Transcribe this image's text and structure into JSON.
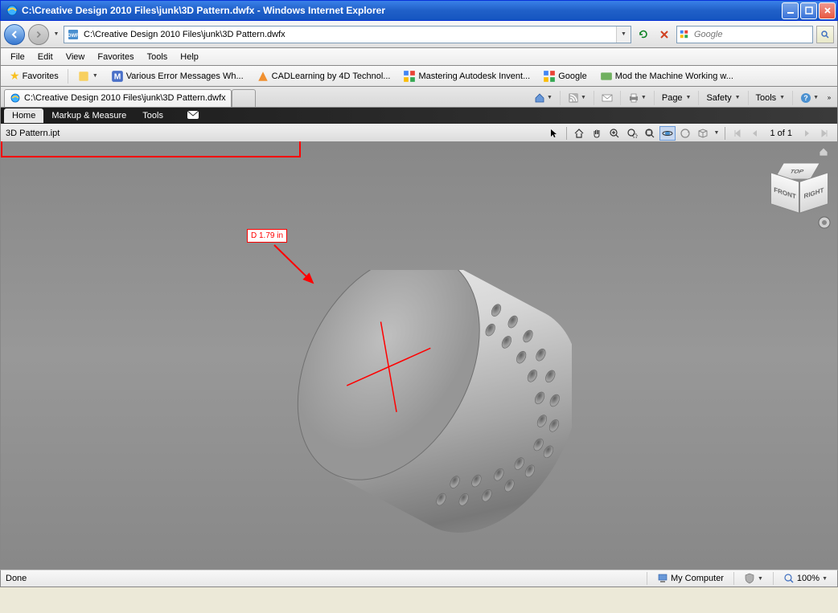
{
  "window": {
    "title": "C:\\Creative Design 2010 Files\\junk\\3D Pattern.dwfx - Windows Internet Explorer"
  },
  "nav": {
    "url": "C:\\Creative Design 2010 Files\\junk\\3D Pattern.dwfx",
    "search_placeholder": "Google"
  },
  "menu": {
    "items": [
      "File",
      "Edit",
      "View",
      "Favorites",
      "Tools",
      "Help"
    ]
  },
  "favorites": {
    "label": "Favorites",
    "items": [
      {
        "label": "Various Error Messages Wh...",
        "icon": "M"
      },
      {
        "label": "CADLearning by 4D Technol...",
        "icon": "A"
      },
      {
        "label": "Mastering Autodesk Invent...",
        "icon": "G"
      },
      {
        "label": "Google",
        "icon": "G"
      },
      {
        "label": "Mod the Machine Working w...",
        "icon": "B"
      }
    ]
  },
  "tab": {
    "label": "C:\\Creative Design 2010 Files\\junk\\3D Pattern.dwfx"
  },
  "command_bar": {
    "page": "Page",
    "safety": "Safety",
    "tools": "Tools"
  },
  "viewer": {
    "menu": [
      "Home",
      "Markup & Measure",
      "Tools"
    ],
    "filename": "3D Pattern.ipt",
    "page_indicator": "1 of 1",
    "cube": {
      "top": "TOP",
      "front": "FRONT",
      "right": "RIGHT"
    }
  },
  "annotation": {
    "label": "D 1.79 in"
  },
  "status": {
    "left": "Done",
    "zone": "My Computer",
    "zoom": "100%"
  }
}
